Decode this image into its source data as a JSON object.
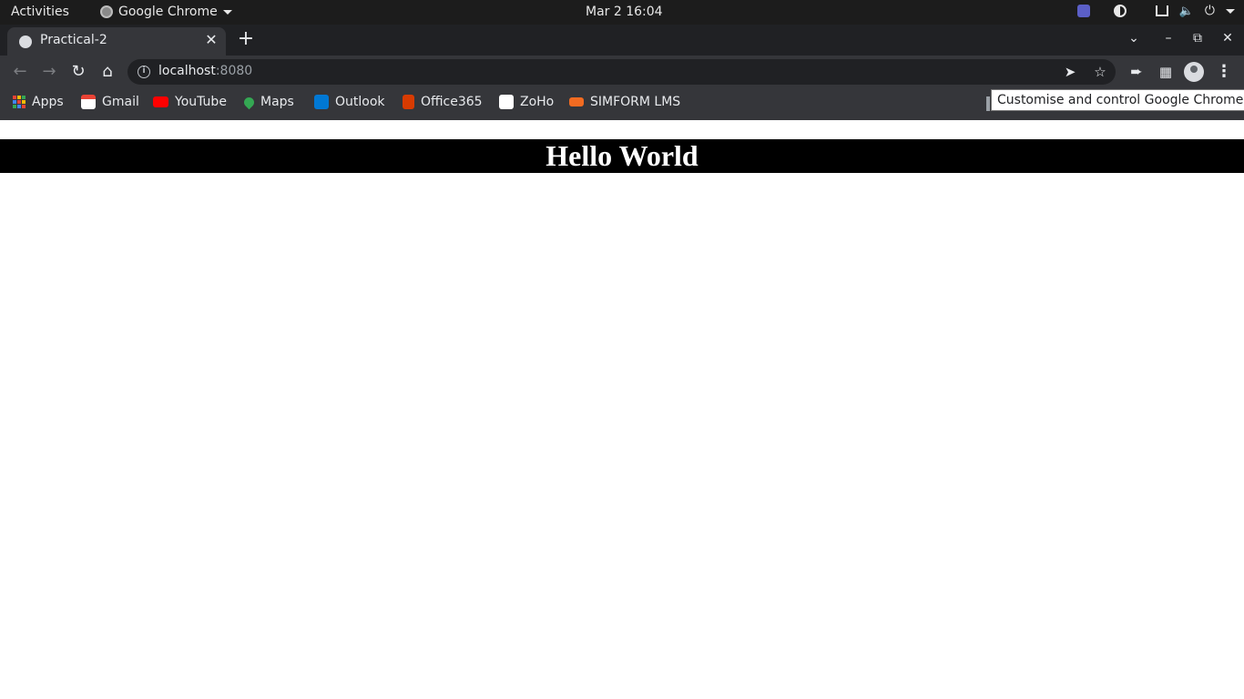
{
  "system_bar": {
    "activities": "Activities",
    "app_name": "Google Chrome",
    "clock": "Mar 2  16:04"
  },
  "tab": {
    "title": "Practical-2"
  },
  "toolbar": {
    "url_host": "localhost",
    "url_port": ":8080"
  },
  "bookmarks": [
    {
      "label": "Apps",
      "icon": "apps-icon"
    },
    {
      "label": "Gmail",
      "icon": "gmail-icon"
    },
    {
      "label": "YouTube",
      "icon": "youtube-icon"
    },
    {
      "label": "Maps",
      "icon": "maps-icon"
    },
    {
      "label": "Outlook",
      "icon": "outlook-icon"
    },
    {
      "label": "Office365",
      "icon": "office365-icon"
    },
    {
      "label": "ZoHo",
      "icon": "zoho-icon"
    },
    {
      "label": "SIMFORM LMS",
      "icon": "simform-icon"
    }
  ],
  "tooltip": "Customise and control Google Chrome",
  "page": {
    "heading": "Hello World"
  },
  "colors": {
    "topbar": "#1c1c1c",
    "tabstrip": "#202124",
    "toolbar": "#35363a",
    "heading_bg": "#000000",
    "heading_text": "#ffffff"
  }
}
